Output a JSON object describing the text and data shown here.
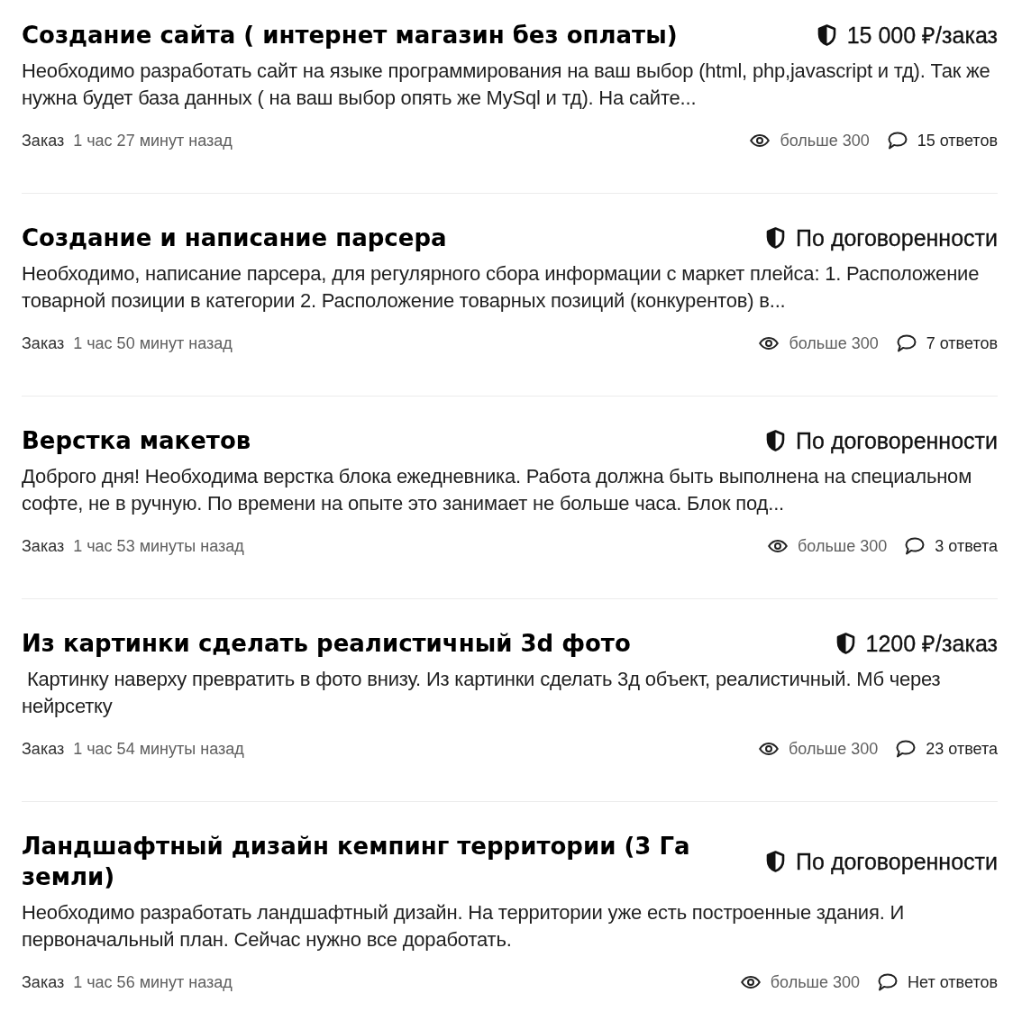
{
  "orders": [
    {
      "title": "Создание сайта ( интернет магазин без оплаты)",
      "price": "15 000 ₽/заказ",
      "description": "Необходимо разработать сайт на языке программирования на ваш выбор (html, php,javascript и тд). Так же нужна будет база данных ( на ваш выбор опять же MySql и тд). На сайте...",
      "type_label": "Заказ",
      "posted": "1 час 27 минут назад",
      "views": "больше 300",
      "responses": "15 ответов"
    },
    {
      "title": "Создание и написание парсера",
      "price": "По договоренности",
      "description": "Необходимо, написание парсера, для регулярного сбора информации с маркет плейса: 1. Расположение товарной позиции в категории 2. Расположение товарных позиций (конкурентов) в...",
      "type_label": "Заказ",
      "posted": "1 час 50 минут назад",
      "views": "больше 300",
      "responses": "7 ответов"
    },
    {
      "title": "Верстка макетов",
      "price": "По договоренности",
      "description": "Доброго дня! Необходима верстка блока ежедневника. Работа должна быть выполнена на специальном софте, не в ручную. По времени на опыте это занимает не больше часа. Блок под...",
      "type_label": "Заказ",
      "posted": "1 час 53 минуты назад",
      "views": "больше 300",
      "responses": "3 ответа"
    },
    {
      "title": "Из картинки сделать реалистичный 3d фото",
      "price": "1200 ₽/заказ",
      "description": " Картинку наверху превратить в фото внизу. Из картинки сделать 3д объект, реалистичный. Мб через нейрсетку",
      "type_label": "Заказ",
      "posted": "1 час 54 минуты назад",
      "views": "больше 300",
      "responses": "23 ответа"
    },
    {
      "title": "Ландшафтный дизайн кемпинг территории (3 Га земли)",
      "price": "По договоренности",
      "description": "Необходимо разработать ландшафтный дизайн. На территории уже есть построенные здания. И первоначальный план. Сейчас нужно все доработать.",
      "type_label": "Заказ",
      "posted": "1 час 56 минут назад",
      "views": "больше 300",
      "responses": "Нет ответов"
    }
  ]
}
